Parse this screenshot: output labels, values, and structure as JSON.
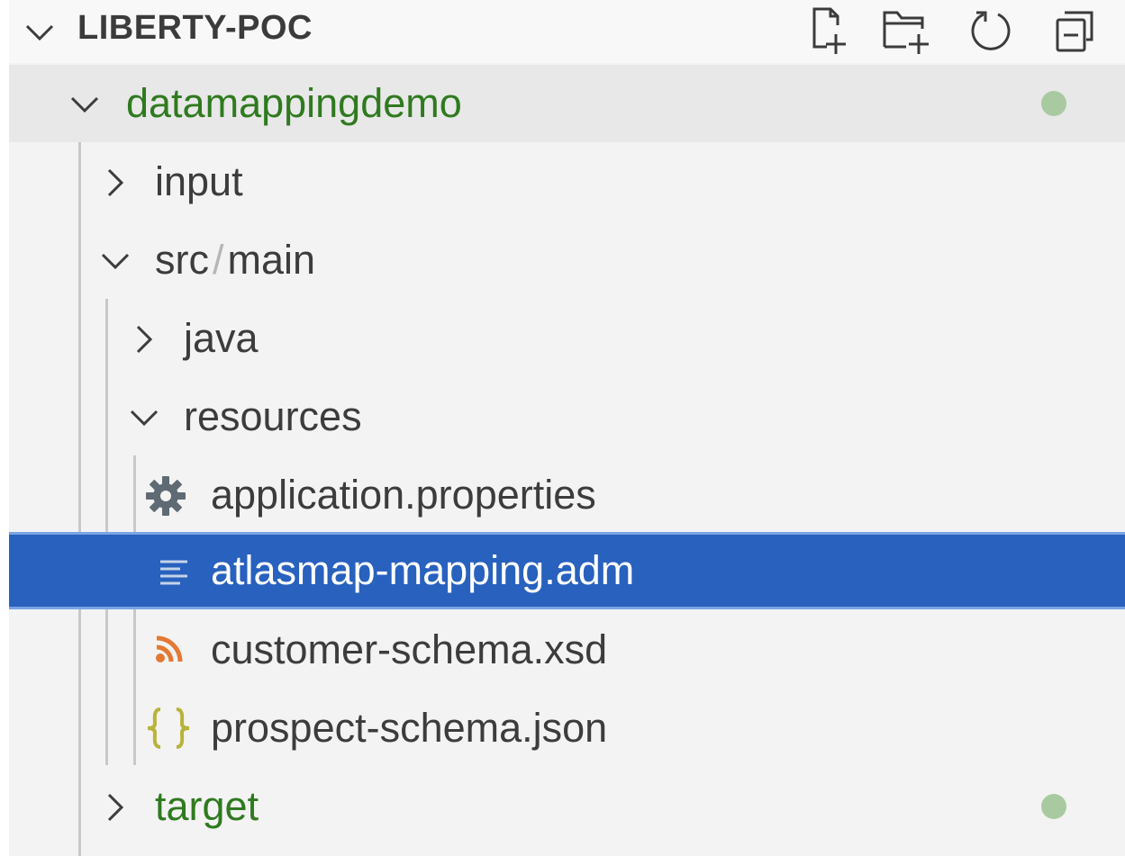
{
  "explorer": {
    "title": "LIBERTY-POC",
    "toolbar": [
      {
        "name": "new-file-icon"
      },
      {
        "name": "new-folder-icon"
      },
      {
        "name": "refresh-icon"
      },
      {
        "name": "collapse-all-icon"
      }
    ]
  },
  "tree": {
    "root": {
      "label": "datamappingdemo",
      "status_color": "#a9c9a0"
    },
    "input": {
      "label": "input"
    },
    "src_main": {
      "part1": "src",
      "separator": "/",
      "part2": "main"
    },
    "java": {
      "label": "java"
    },
    "resources": {
      "label": "resources"
    },
    "files": [
      {
        "label": "application.properties",
        "icon": "gear-icon",
        "icon_color": "#5f6a73"
      },
      {
        "label": "atlasmap-mapping.adm",
        "icon": "text-lines-icon",
        "icon_color": "#c5d3ea",
        "selected": true
      },
      {
        "label": "customer-schema.xsd",
        "icon": "rss-icon",
        "icon_color": "#e37933"
      },
      {
        "label": "prospect-schema.json",
        "icon": "braces-icon",
        "icon_color": "#b8b33a"
      }
    ],
    "target": {
      "label": "target",
      "status_color": "#a9c9a0"
    }
  },
  "colors": {
    "selection": "#2861be",
    "folder_modified": "#2f7a1f",
    "panel_bg": "#f3f3f3"
  }
}
